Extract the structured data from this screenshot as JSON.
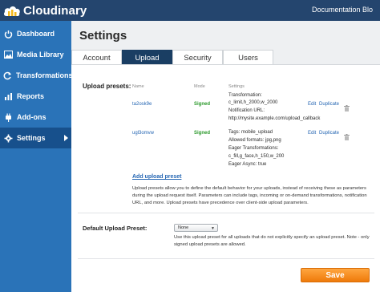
{
  "app": {
    "name": "Cloudinary"
  },
  "topnav": {
    "documentation": "Documentation",
    "blog": "Blo"
  },
  "sidebar": {
    "items": [
      {
        "label": "Dashboard",
        "icon": "power-icon"
      },
      {
        "label": "Media Library",
        "icon": "picture-icon"
      },
      {
        "label": "Transformations",
        "icon": "refresh-icon"
      },
      {
        "label": "Reports",
        "icon": "chart-icon"
      },
      {
        "label": "Add-ons",
        "icon": "plug-icon"
      },
      {
        "label": "Settings",
        "icon": "gear-icon",
        "active": true
      }
    ]
  },
  "page": {
    "title": "Settings"
  },
  "tabs": [
    {
      "label": "Account"
    },
    {
      "label": "Upload",
      "active": true
    },
    {
      "label": "Security"
    },
    {
      "label": "Users"
    }
  ],
  "upload_presets": {
    "label": "Upload presets:",
    "columns": {
      "name": "Name",
      "mode": "Mode",
      "settings": "Settings"
    },
    "rows": [
      {
        "name": "ta2osk9e",
        "mode": "Signed",
        "settings": [
          "Transformation:",
          "c_limit,h_2000,w_2000",
          "Notification URL:",
          "http://mysite.example.com/upload_callback"
        ],
        "edit": "Edit",
        "duplicate": "Duplicate"
      },
      {
        "name": "ugl3omvw",
        "mode": "Signed",
        "settings": [
          "Tags: mobile_upload",
          "Allowed formats: jpg,png",
          "Eager Transformations:",
          "c_fill,g_face,h_150,w_200",
          "Eager Async: true"
        ],
        "edit": "Edit",
        "duplicate": "Duplicate"
      }
    ],
    "add_link": "Add upload preset",
    "description": [
      "Upload presets allow you to define the default behavior for your uploads, instead of receiving these as parameters",
      "during the upload request itself. Parameters can include tags, incoming or on-demand transformations, notification",
      "URL, and more. Upload presets have precedence over client-side upload parameters."
    ]
  },
  "default_preset": {
    "label": "Default Upload Preset:",
    "selected": "None",
    "note": [
      "Use this upload preset for all uploads that do not explicitly specify an upload preset. Note - only",
      "signed upload presets are allowed."
    ]
  },
  "save_label": "Save",
  "colors": {
    "topbar": "#24456e",
    "sidebar": "#2a73b8",
    "sidebar_active": "#17508c",
    "tab_active": "#1a3e63",
    "link": "#2566b3",
    "signed": "#2d9a2d",
    "save": "#f28c1e"
  }
}
